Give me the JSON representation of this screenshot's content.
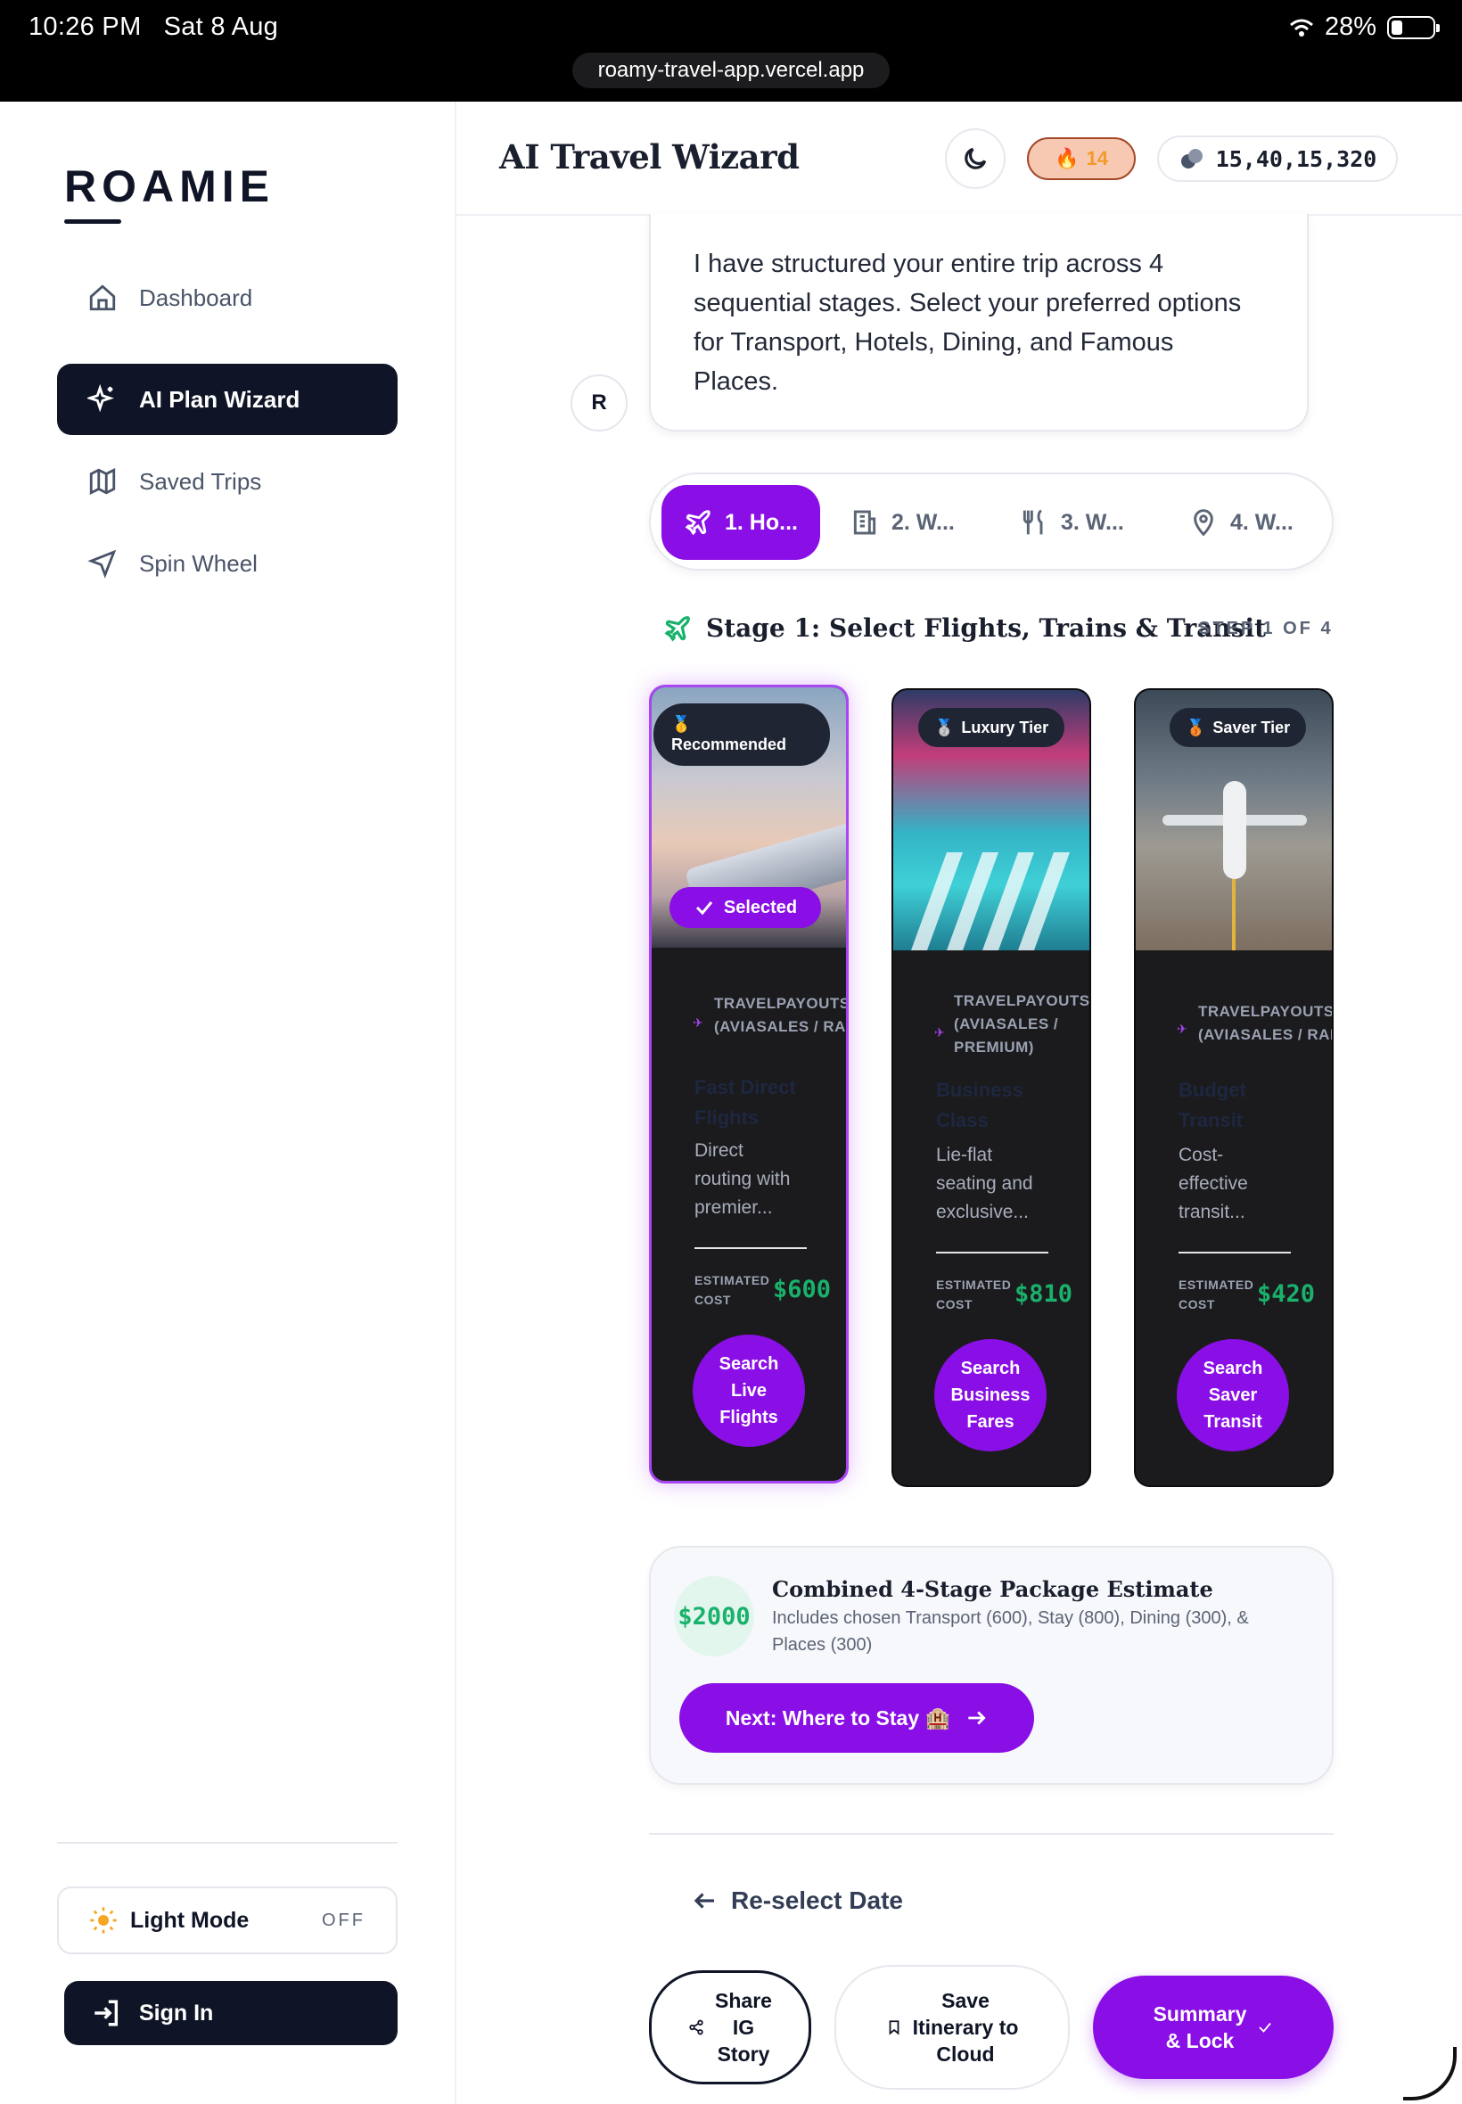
{
  "status_bar": {
    "time": "10:26 PM",
    "date": "Sat 8 Aug",
    "battery": "28%",
    "url": "roamy-travel-app.vercel.app"
  },
  "sidebar": {
    "logo": "ROAMIE",
    "items": [
      {
        "label": "Dashboard",
        "icon": "home-icon",
        "active": false
      },
      {
        "label": "AI Plan Wizard",
        "icon": "sparkles-icon",
        "active": true
      },
      {
        "label": "Saved Trips",
        "icon": "map-icon",
        "active": false
      },
      {
        "label": "Spin Wheel",
        "icon": "navigation-icon",
        "active": false
      }
    ],
    "light_mode": {
      "label": "Light Mode",
      "state": "OFF"
    },
    "sign_in": "Sign In"
  },
  "header": {
    "title": "AI Travel Wizard",
    "streak": "14",
    "coins": "15,40,15,320"
  },
  "chat": {
    "avatar": "R",
    "message": "I have structured your entire trip across 4 sequential stages. Select your preferred options for Transport, Hotels, Dining, and Famous Places."
  },
  "tabs": [
    {
      "label": "1. Ho...",
      "icon": "plane-icon",
      "active": true
    },
    {
      "label": "2. W...",
      "icon": "building-icon",
      "active": false
    },
    {
      "label": "3. W...",
      "icon": "utensils-icon",
      "active": false
    },
    {
      "label": "4. W...",
      "icon": "map-pin-icon",
      "active": false
    }
  ],
  "stage": {
    "title": "Stage 1: Select Flights, Trains & Transit",
    "step": "STEP 1 OF 4"
  },
  "cards": [
    {
      "badge": "Recommended",
      "badge_icon": "🥇",
      "selected_label": "Selected",
      "provider_line1": "TRAVELPAYOUTS",
      "provider_line2": "(AVIASALES / RAIL",
      "title_line1": "Fast Direct",
      "title_line2": "Flights",
      "desc_line1": "Direct",
      "desc_line2": "routing with",
      "desc_line3": "premier...",
      "cost_label_1": "ESTIMATED",
      "cost_label_2": "COST",
      "cost": "$600",
      "cta_line1": "Search",
      "cta_line2": "Live",
      "cta_line3": "Flights"
    },
    {
      "badge": "Luxury Tier",
      "badge_icon": "🥈",
      "provider_line1": "TRAVELPAYOUTS",
      "provider_line2": "(AVIASALES /",
      "provider_line3": "PREMIUM)",
      "title_line1": "Business",
      "title_line2": "Class",
      "desc_line1": "Lie-flat",
      "desc_line2": "seating and",
      "desc_line3": "exclusive...",
      "cost_label_1": "ESTIMATED",
      "cost_label_2": "COST",
      "cost": "$810",
      "cta_line1": "Search",
      "cta_line2": "Business",
      "cta_line3": "Fares"
    },
    {
      "badge": "Saver Tier",
      "badge_icon": "🥉",
      "provider_line1": "TRAVELPAYOUTS",
      "provider_line2": "(AVIASALES / RAIL",
      "title_line1": "Budget",
      "title_line2": "Transit",
      "desc_line1": "Cost-",
      "desc_line2": "effective",
      "desc_line3": "transit...",
      "cost_label_1": "ESTIMATED",
      "cost_label_2": "COST",
      "cost": "$420",
      "cta_line1": "Search",
      "cta_line2": "Saver",
      "cta_line3": "Transit"
    }
  ],
  "package": {
    "amount": "$2000",
    "title": "Combined 4-Stage Package Estimate",
    "description": "Includes chosen Transport (600), Stay (800), Dining (300), & Places (300)",
    "next_button": "Next: Where to Stay 🏨"
  },
  "reselect": "Re-select Date",
  "actions": {
    "share_line1": "Share",
    "share_line2": "IG",
    "share_line3": "Story",
    "save_line1": "Save",
    "save_line2": "Itinerary to",
    "save_line3": "Cloud",
    "summary_line1": "Summary",
    "summary_line2": "& Lock"
  },
  "colors": {
    "accent": "#8a0ee6",
    "navy": "#0f1526",
    "cost_green": "#19b16b"
  }
}
